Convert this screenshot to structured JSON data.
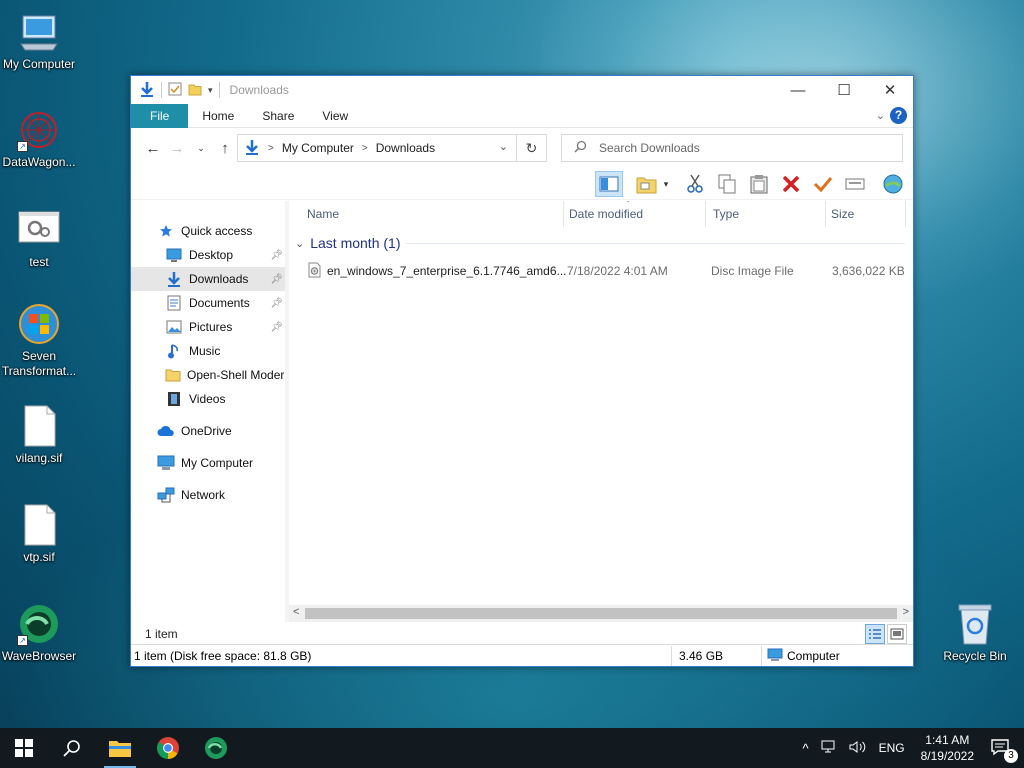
{
  "desktop": {
    "icons": [
      {
        "label": "My Computer"
      },
      {
        "label": "DataWagon..."
      },
      {
        "label": "test"
      },
      {
        "label": "Seven Transformat..."
      },
      {
        "label": "vilang.sif"
      },
      {
        "label": "vtp.sif"
      },
      {
        "label": "WaveBrowser"
      },
      {
        "label": "Recycle Bin"
      }
    ]
  },
  "window": {
    "title": "Downloads",
    "ribbon_tabs": [
      "File",
      "Home",
      "Share",
      "View"
    ],
    "help": "?",
    "address": {
      "crumbs": [
        "My Computer",
        "Downloads"
      ]
    },
    "search_placeholder": "Search Downloads",
    "nav": [
      {
        "label": "Quick access",
        "icon": "star-icon"
      },
      {
        "label": "Desktop",
        "icon": "desktop-icon",
        "pinned": true
      },
      {
        "label": "Downloads",
        "icon": "download-icon",
        "pinned": true,
        "selected": true
      },
      {
        "label": "Documents",
        "icon": "documents-icon",
        "pinned": true
      },
      {
        "label": "Pictures",
        "icon": "pictures-icon",
        "pinned": true
      },
      {
        "label": "Music",
        "icon": "music-icon"
      },
      {
        "label": "Open-Shell Modern",
        "icon": "folder-icon"
      },
      {
        "label": "Videos",
        "icon": "videos-icon"
      },
      {
        "label": "OneDrive",
        "icon": "cloud-icon"
      },
      {
        "label": "My Computer",
        "icon": "computer-icon"
      },
      {
        "label": "Network",
        "icon": "network-icon"
      }
    ],
    "columns": [
      "Name",
      "Date modified",
      "Type",
      "Size"
    ],
    "group": "Last month (1)",
    "files": [
      {
        "name": "en_windows_7_enterprise_6.1.7746_amd6...",
        "date": "7/18/2022 4:01 AM",
        "type": "Disc Image File",
        "size": "3,636,022 KB"
      }
    ],
    "item_count": "1 item",
    "status": {
      "left": "1 item (Disk free space: 81.8 GB)",
      "size": "3.46 GB",
      "location": "Computer"
    }
  },
  "taskbar": {
    "lang": "ENG",
    "time": "1:41 AM",
    "date": "8/19/2022",
    "notifications": "3"
  }
}
